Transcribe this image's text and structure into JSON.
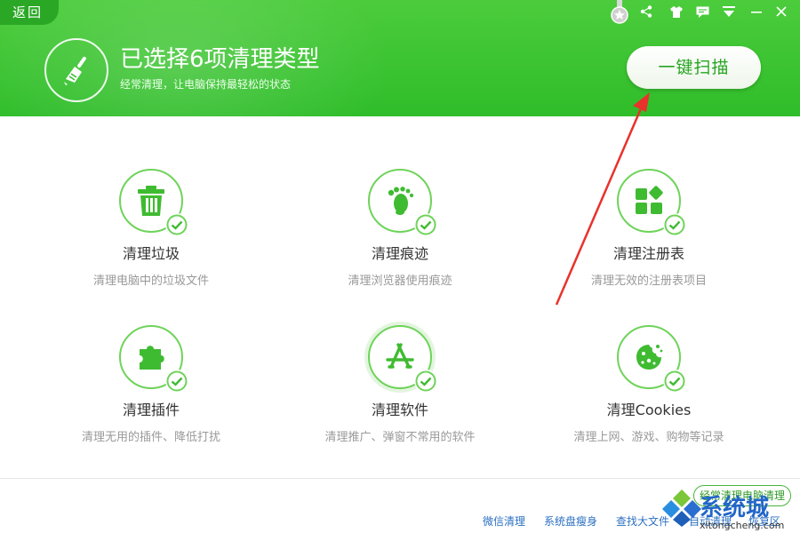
{
  "header": {
    "back_label": "返回",
    "title": "已选择6项清理类型",
    "subtitle": "经常清理，让电脑保持最轻松的状态",
    "scan_button": "一键扫描"
  },
  "items": [
    {
      "label": "清理垃圾",
      "desc": "清理电脑中的垃圾文件",
      "icon": "trash-icon",
      "checked": true
    },
    {
      "label": "清理痕迹",
      "desc": "清理浏览器使用痕迹",
      "icon": "footprint-icon",
      "checked": true
    },
    {
      "label": "清理注册表",
      "desc": "清理无效的注册表项目",
      "icon": "registry-blocks-icon",
      "checked": true
    },
    {
      "label": "清理插件",
      "desc": "清理无用的插件、降低打扰",
      "icon": "puzzle-icon",
      "checked": true
    },
    {
      "label": "清理软件",
      "desc": "清理推广、弹窗不常用的软件",
      "icon": "app-store-icon",
      "checked": true
    },
    {
      "label": "清理Cookies",
      "desc": "清理上网、游戏、购物等记录",
      "icon": "cookie-icon",
      "checked": true
    }
  ],
  "footer": {
    "links": [
      "微信清理",
      "系统盘瘦身",
      "查找大文件",
      "自动清理",
      "恢复区"
    ],
    "pill_label": "经常清理电脑清理"
  },
  "watermark": {
    "main": "系统城",
    "sub": "xitongcheng.com"
  },
  "colors": {
    "brand_green": "#2fbd2a",
    "accent_green": "#26a520",
    "link_blue": "#2b6fc0",
    "arrow_red": "#e8322b"
  }
}
